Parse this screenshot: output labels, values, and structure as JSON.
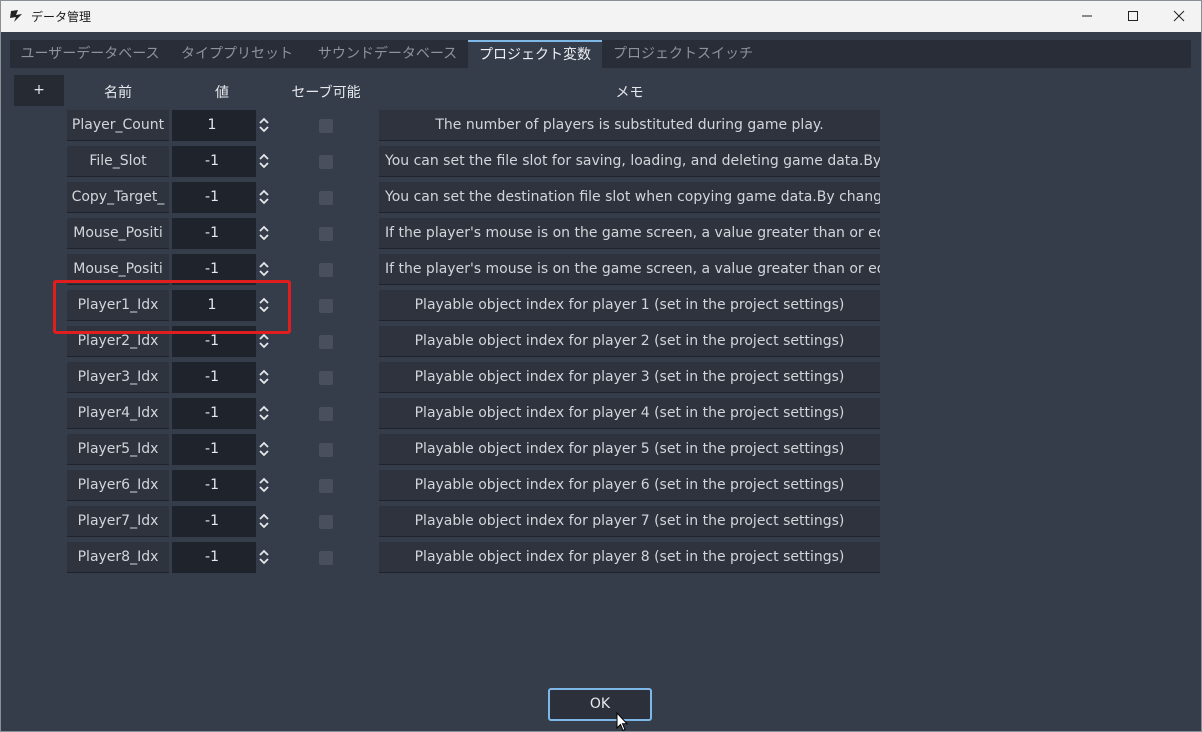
{
  "window": {
    "title": "データ管理"
  },
  "tabs": [
    {
      "label": "ユーザーデータベース"
    },
    {
      "label": "タイププリセット"
    },
    {
      "label": "サウンドデータベース"
    },
    {
      "label": "プロジェクト変数"
    },
    {
      "label": "プロジェクトスイッチ"
    }
  ],
  "table": {
    "add_label": "+",
    "headers": {
      "name": "名前",
      "value": "値",
      "saveable": "セーブ可能",
      "memo": "メモ"
    },
    "rows": [
      {
        "name": "Player_Count",
        "value": "1",
        "saveable": false,
        "memo": "The number of players is substituted during game play."
      },
      {
        "name": "File_Slot",
        "value": "-1",
        "saveable": false,
        "memo": "You can set the file slot for saving, loading, and deleting game data.By spe"
      },
      {
        "name": "Copy_Target_",
        "value": "-1",
        "saveable": false,
        "memo": "You can set the destination file slot when copying game data.By changing"
      },
      {
        "name": "Mouse_Positi",
        "value": "-1",
        "saveable": false,
        "memo": "If the player's mouse is on the game screen, a value greater than or equal"
      },
      {
        "name": "Mouse_Positi",
        "value": "-1",
        "saveable": false,
        "memo": "If the player's mouse is on the game screen, a value greater than or equal"
      },
      {
        "name": "Player1_Idx",
        "value": "1",
        "saveable": false,
        "memo": "Playable object index for player 1 (set in the project settings)"
      },
      {
        "name": "Player2_Idx",
        "value": "-1",
        "saveable": false,
        "memo": "Playable object index for player 2 (set in the project settings)"
      },
      {
        "name": "Player3_Idx",
        "value": "-1",
        "saveable": false,
        "memo": "Playable object index for player 3 (set in the project settings)"
      },
      {
        "name": "Player4_Idx",
        "value": "-1",
        "saveable": false,
        "memo": "Playable object index for player 4 (set in the project settings)"
      },
      {
        "name": "Player5_Idx",
        "value": "-1",
        "saveable": false,
        "memo": "Playable object index for player 5 (set in the project settings)"
      },
      {
        "name": "Player6_Idx",
        "value": "-1",
        "saveable": false,
        "memo": "Playable object index for player 6 (set in the project settings)"
      },
      {
        "name": "Player7_Idx",
        "value": "-1",
        "saveable": false,
        "memo": "Playable object index for player 7 (set in the project settings)"
      },
      {
        "name": "Player8_Idx",
        "value": "-1",
        "saveable": false,
        "memo": "Playable object index for player 8 (set in the project settings)"
      }
    ]
  },
  "footer": {
    "ok_label": "OK"
  },
  "colors": {
    "accent": "#7db8e8",
    "highlight": "#e01e1e",
    "panel": "#363d4a"
  },
  "icons": [
    "app-icon",
    "minimize-icon",
    "maximize-icon",
    "close-icon",
    "spinner-arrows-icon",
    "mouse-cursor-icon"
  ]
}
